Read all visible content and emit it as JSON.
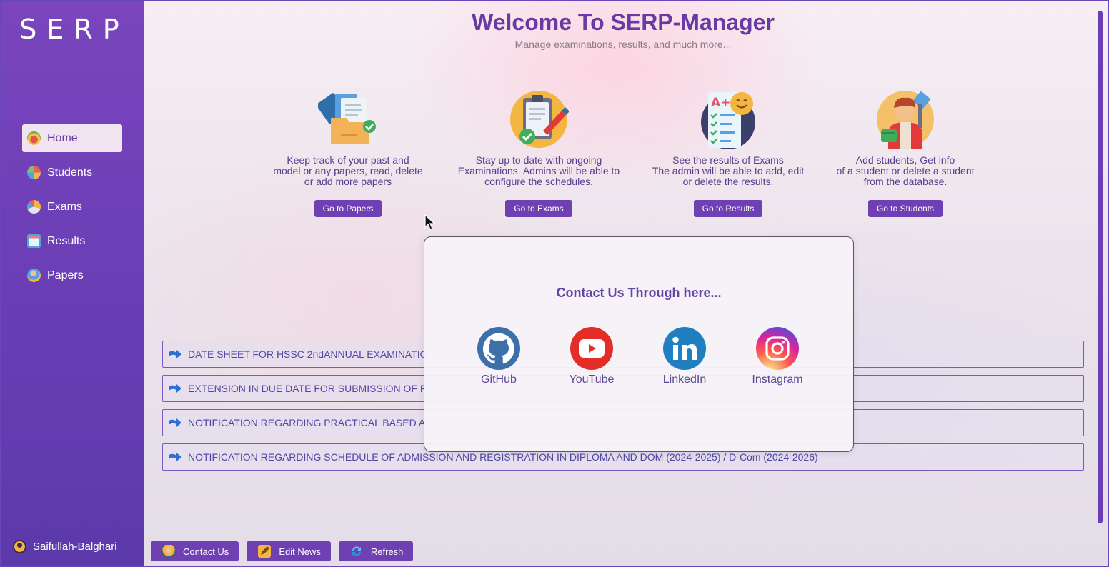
{
  "sidebar": {
    "logo": "SERP",
    "items": [
      {
        "label": "Home",
        "active": true,
        "icon": "home-icon"
      },
      {
        "label": "Students",
        "active": false,
        "icon": "students-icon"
      },
      {
        "label": "Exams",
        "active": false,
        "icon": "exams-icon"
      },
      {
        "label": "Results",
        "active": false,
        "icon": "results-icon"
      },
      {
        "label": "Papers",
        "active": false,
        "icon": "papers-icon"
      }
    ],
    "user": "Saifullah-Balghari"
  },
  "header": {
    "title": "Welcome To SERP-Manager",
    "subtitle": "Manage examinations, results, and much more..."
  },
  "cards": [
    {
      "icon": "papers-folder-icon",
      "text": "Keep track of your past and\nmodel or any papers, read, delete\nor add more papers",
      "button": "Go to Papers"
    },
    {
      "icon": "exams-clipboard-icon",
      "text": "Stay up to date with ongoing\nExaminations. Admins will be able to\nconfigure the schedules.",
      "button": "Go to Exams"
    },
    {
      "icon": "results-sheet-icon",
      "text": "See the results of Exams\nThe admin will be able to add, edit\nor delete the results.",
      "button": "Go to Results"
    },
    {
      "icon": "students-person-icon",
      "text": "Add students, Get info\nof a student or delete a student\nfrom the database.",
      "button": "Go to Students"
    }
  ],
  "news": [
    "DATE SHEET FOR HSSC 2ndANNUAL EXAMINATIO",
    "EXTENSION IN DUE DATE FOR SUBMISSION OF F",
    "NOTIFICATION REGARDING PRACTICAL BASED A",
    "NOTIFICATION REGARDING SCHEDULE OF ADMISSION AND REGISTRATION IN DIPLOMA AND DOM (2024-2025) / D-Com (2024-2026)"
  ],
  "bottom_bar": {
    "contact": "Contact Us",
    "edit_news": "Edit News",
    "refresh": "Refresh"
  },
  "modal": {
    "title": "Contact Us Through here...",
    "links": [
      {
        "label": "GitHub",
        "icon": "github-icon",
        "color": "#3d6fa9"
      },
      {
        "label": "YouTube",
        "icon": "youtube-icon",
        "color": "#e52d27"
      },
      {
        "label": "LinkedIn",
        "icon": "linkedin-icon",
        "color": "#1f7fbf"
      },
      {
        "label": "Instagram",
        "icon": "instagram-icon",
        "color": "#e1306c"
      }
    ]
  },
  "colors": {
    "sidebar": "#6c3fb6",
    "accent": "#6f3fb4",
    "title": "#6a3aa3"
  }
}
